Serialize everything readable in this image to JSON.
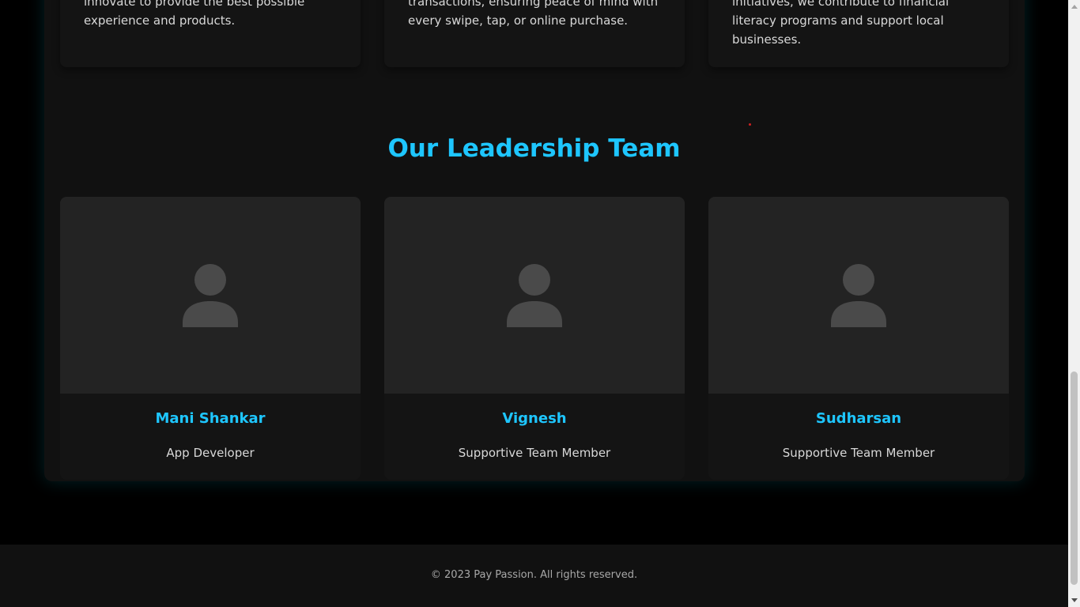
{
  "values_section": {
    "cards": [
      {
        "text": "innovate to provide the best possible experience and products."
      },
      {
        "text": "transactions, ensuring peace of mind with every swipe, tap, or online purchase."
      },
      {
        "text": "initiatives, we contribute to financial literacy programs and support local businesses."
      }
    ]
  },
  "team_section": {
    "title": "Our Leadership Team",
    "members": [
      {
        "name": "Mani Shankar",
        "role": "App Developer",
        "avatar_icon": "person-placeholder-icon"
      },
      {
        "name": "Vignesh",
        "role": "Supportive Team Member",
        "avatar_icon": "person-placeholder-icon"
      },
      {
        "name": "Sudharsan",
        "role": "Supportive Team Member",
        "avatar_icon": "person-placeholder-icon"
      }
    ]
  },
  "footer": {
    "copyright": "© 2023 Pay Passion. All rights reserved."
  },
  "colors": {
    "accent": "#1ec6ff",
    "background": "#000000",
    "panel": "#111111",
    "card": "#141414",
    "photo_bg": "#232323",
    "avatar": "#4a4a4a"
  }
}
